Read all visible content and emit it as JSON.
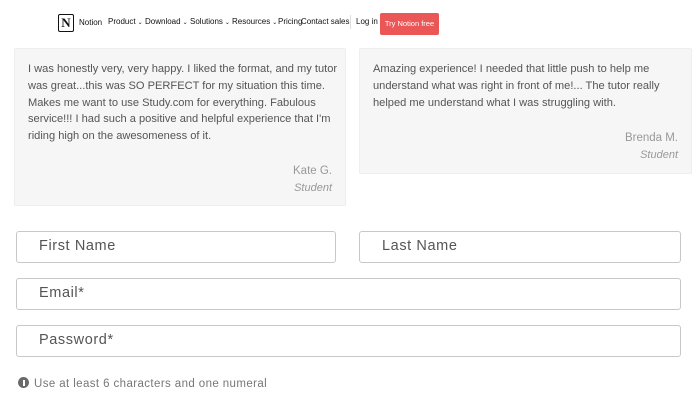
{
  "nav": {
    "logo_glyph": "N",
    "brand": "Notion",
    "items": [
      {
        "label": "Product",
        "dropdown": true
      },
      {
        "label": "Download",
        "dropdown": true
      },
      {
        "label": "Solutions",
        "dropdown": true
      },
      {
        "label": "Resources",
        "dropdown": true
      },
      {
        "label": "Pricing",
        "dropdown": false
      },
      {
        "label": "Contact sales",
        "dropdown": false
      }
    ],
    "login": "Log in",
    "cta": "Try Notion free",
    "cta_color": "#eb5757"
  },
  "testimonials": [
    {
      "quote": "I was honestly very, very happy. I liked the format, and my tutor was great...this was SO PERFECT for my situation this time. Makes me want to use Study.com for everything. Fabulous service!!! I had such a positive and helpful experience that I'm riding high on the awesomeness of it.",
      "author": "Kate G.",
      "role": "Student"
    },
    {
      "quote": "Amazing experience! I needed that little push to help me understand what was right in front of me!... The tutor really helped me understand what I was struggling with.",
      "author": "Brenda M.",
      "role": "Student"
    }
  ],
  "form": {
    "first_name": {
      "placeholder": "First Name",
      "value": ""
    },
    "last_name": {
      "placeholder": "Last Name",
      "value": ""
    },
    "email": {
      "placeholder": "Email*",
      "value": ""
    },
    "password": {
      "placeholder": "Password*",
      "value": ""
    },
    "hint": "Use at least 6 characters and one numeral",
    "hint_icon": "info-icon"
  }
}
